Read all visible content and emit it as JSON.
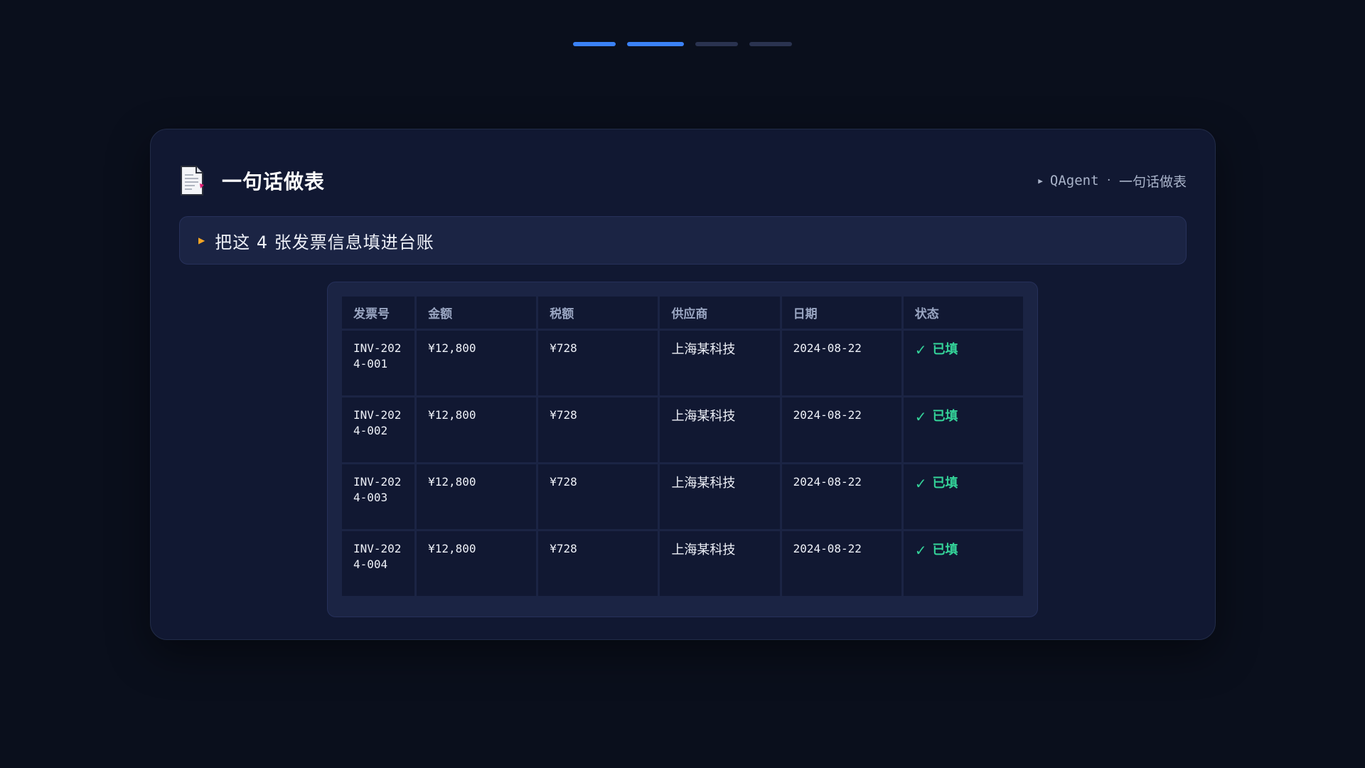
{
  "progress": [
    {
      "state": "done"
    },
    {
      "state": "current"
    },
    {
      "state": "pending"
    },
    {
      "state": "pending"
    }
  ],
  "header": {
    "icon": "document-icon",
    "title": "一句话做表",
    "breadcrumb": {
      "product": "QAgent",
      "separator": "·",
      "page": "一句话做表"
    }
  },
  "prompt": {
    "text": "把这 4 张发票信息填进台账"
  },
  "table": {
    "columns": [
      "发票号",
      "金额",
      "税额",
      "供应商",
      "日期",
      "状态"
    ],
    "rows": [
      {
        "invoice": "INV-2024-001",
        "amount": "¥12,800",
        "tax": "¥728",
        "vendor": "上海某科技",
        "date": "2024-08-22",
        "status": "已填",
        "status_icon": "✓"
      },
      {
        "invoice": "INV-2024-002",
        "amount": "¥12,800",
        "tax": "¥728",
        "vendor": "上海某科技",
        "date": "2024-08-22",
        "status": "已填",
        "status_icon": "✓"
      },
      {
        "invoice": "INV-2024-003",
        "amount": "¥12,800",
        "tax": "¥728",
        "vendor": "上海某科技",
        "date": "2024-08-22",
        "status": "已填",
        "status_icon": "✓"
      },
      {
        "invoice": "INV-2024-004",
        "amount": "¥12,800",
        "tax": "¥728",
        "vendor": "上海某科技",
        "date": "2024-08-22",
        "status": "已填",
        "status_icon": "✓"
      }
    ]
  },
  "colors": {
    "accent": "#3b82f6",
    "success": "#34d399",
    "prompt_marker": "#f5a524",
    "background": "#0a0f1c"
  }
}
